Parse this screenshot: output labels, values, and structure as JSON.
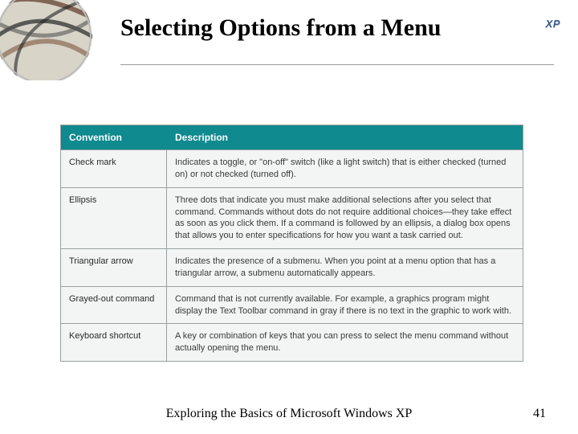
{
  "title": "Selecting Options from a Menu",
  "badge": "XP",
  "table": {
    "headers": {
      "convention": "Convention",
      "description": "Description"
    },
    "rows": [
      {
        "name": "Check mark",
        "desc": "Indicates a toggle, or \"on-off\" switch (like a light switch) that is either checked (turned on) or not checked (turned off)."
      },
      {
        "name": "Ellipsis",
        "desc": "Three dots that indicate you must make additional selections after you select that command. Commands without dots do not require additional choices—they take effect as soon as you click them. If a command is followed by an ellipsis, a dialog box opens that allows you to enter specifications for how you want a task carried out."
      },
      {
        "name": "Triangular arrow",
        "desc": "Indicates the presence of a submenu. When you point at a menu option that has a triangular arrow, a submenu automatically appears."
      },
      {
        "name": "Grayed-out command",
        "desc": "Command that is not currently available. For example, a graphics program might display the Text Toolbar command in gray if there is no text in the graphic to work with."
      },
      {
        "name": "Keyboard shortcut",
        "desc": "A key or combination of keys that you can press to select the menu command without actually opening the menu."
      }
    ]
  },
  "footer": "Exploring the Basics of Microsoft Windows XP",
  "page": "41"
}
